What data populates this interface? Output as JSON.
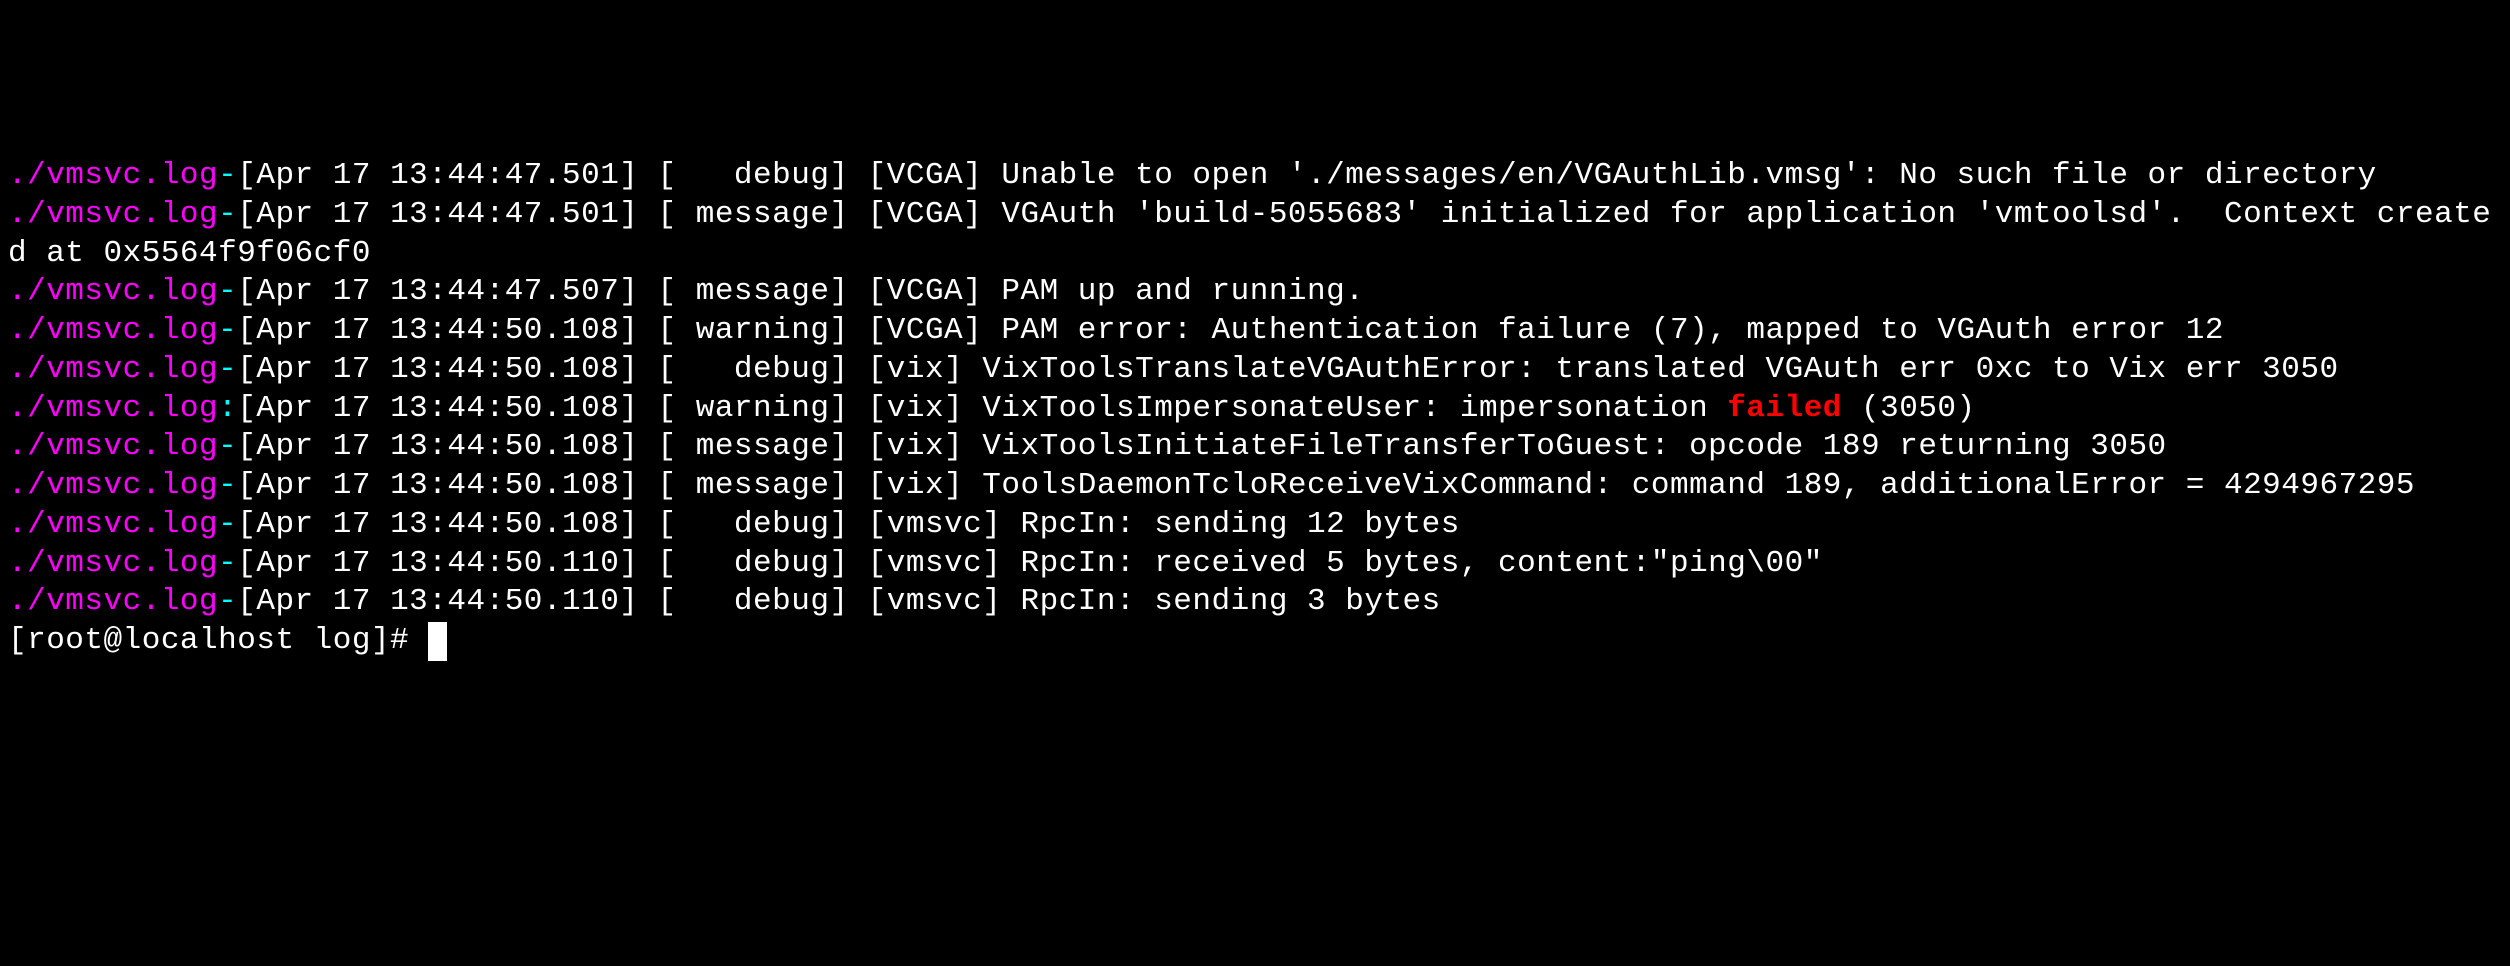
{
  "lines": [
    {
      "file": "./vmsvc.log",
      "sep": "-",
      "rest": "[Apr 17 13:44:47.501] [   debug] [VCGA] Unable to open './messages/en/VGAuthLib.vmsg': No such file or directory"
    },
    {
      "file": "./vmsvc.log",
      "sep": "-",
      "rest": "[Apr 17 13:44:47.501] [ message] [VCGA] VGAuth 'build-5055683' initialized for application 'vmtoolsd'.  Context created at 0x5564f9f06cf0"
    },
    {
      "file": "./vmsvc.log",
      "sep": "-",
      "rest": "[Apr 17 13:44:47.507] [ message] [VCGA] PAM up and running."
    },
    {
      "file": "./vmsvc.log",
      "sep": "-",
      "rest": "[Apr 17 13:44:50.108] [ warning] [VCGA] PAM error: Authentication failure (7), mapped to VGAuth error 12"
    },
    {
      "file": "./vmsvc.log",
      "sep": "-",
      "rest": "[Apr 17 13:44:50.108] [   debug] [vix] VixToolsTranslateVGAuthError: translated VGAuth err 0xc to Vix err 3050"
    },
    {
      "file": "./vmsvc.log",
      "sep": ":",
      "restA": "[Apr 17 13:44:50.108] [ warning] [vix] VixToolsImpersonateUser: impersonation ",
      "failed": "failed",
      "restB": " (3050)"
    },
    {
      "file": "./vmsvc.log",
      "sep": "-",
      "rest": "[Apr 17 13:44:50.108] [ message] [vix] VixToolsInitiateFileTransferToGuest: opcode 189 returning 3050"
    },
    {
      "file": "./vmsvc.log",
      "sep": "-",
      "rest": "[Apr 17 13:44:50.108] [ message] [vix] ToolsDaemonTcloReceiveVixCommand: command 189, additionalError = 4294967295"
    },
    {
      "file": "./vmsvc.log",
      "sep": "-",
      "rest": "[Apr 17 13:44:50.108] [   debug] [vmsvc] RpcIn: sending 12 bytes"
    },
    {
      "file": "./vmsvc.log",
      "sep": "-",
      "rest": "[Apr 17 13:44:50.110] [   debug] [vmsvc] RpcIn: received 5 bytes, content:\"ping\\00\""
    },
    {
      "file": "./vmsvc.log",
      "sep": "-",
      "rest": "[Apr 17 13:44:50.110] [   debug] [vmsvc] RpcIn: sending 3 bytes"
    }
  ],
  "prompt": "[root@localhost log]# "
}
